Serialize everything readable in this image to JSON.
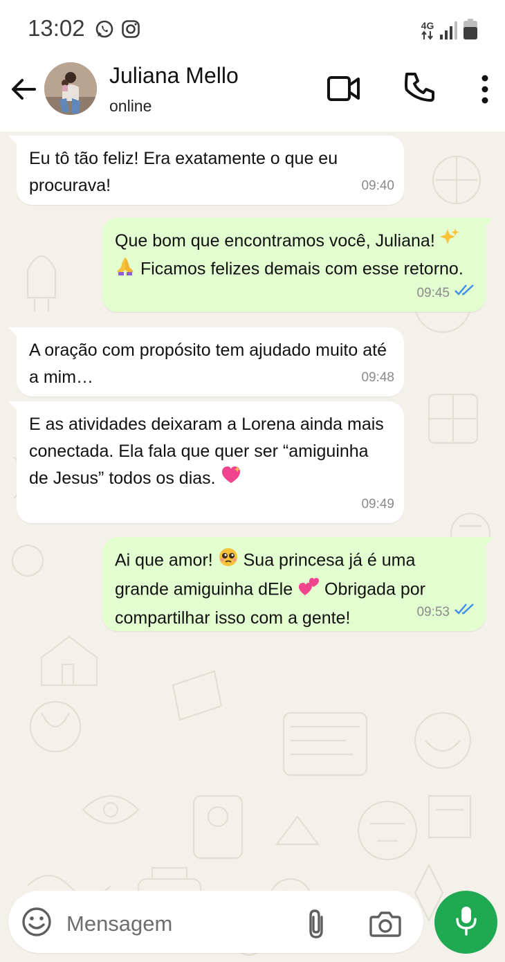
{
  "status_bar": {
    "time": "13:02",
    "left_icons": [
      "whatsapp-icon",
      "instagram-icon"
    ],
    "network": "4G",
    "right_icons": [
      "network-arrows-icon",
      "signal-icon",
      "battery-icon"
    ]
  },
  "header": {
    "contact_name": "Juliana Mello",
    "contact_status": "online",
    "icons": [
      "back-arrow-icon",
      "video-call-icon",
      "phone-call-icon",
      "more-options-icon"
    ]
  },
  "messages": [
    {
      "direction": "in",
      "text": "Eu tô tão feliz! Era exatamente o que eu procurava!",
      "time": "09:40"
    },
    {
      "direction": "out",
      "text_parts": [
        "Que bom que encontramos você, Juliana! ",
        " ",
        " Ficamos felizes demais com esse retorno."
      ],
      "emojis": [
        "sparkles-emoji",
        "praying-hands-emoji"
      ],
      "time": "09:45",
      "read": true
    },
    {
      "direction": "in",
      "text": "A oração com propósito tem ajudado muito até a mim…",
      "time": "09:48"
    },
    {
      "direction": "in",
      "text": "E as atividades deixaram a Lorena ainda mais conectada. Ela fala que quer ser “amiguinha de Jesus” todos os dias. ",
      "emojis": [
        "sparkling-heart-emoji"
      ],
      "time": "09:49"
    },
    {
      "direction": "out",
      "text_parts": [
        "Ai que amor! ",
        " Sua princesa já é uma grande amiguinha dEle ",
        " Obrigada por compartilhar isso com a gente!"
      ],
      "emojis": [
        "pleading-face-emoji",
        "two-hearts-emoji"
      ],
      "time": "09:53",
      "read": true
    }
  ],
  "composer": {
    "placeholder": "Mensagem",
    "icons": [
      "emoji-icon",
      "attach-icon",
      "camera-icon",
      "microphone-icon"
    ]
  },
  "colors": {
    "outgoing_bubble": "#e2fdd0",
    "incoming_bubble": "#ffffff",
    "chat_background": "#f4f1ea",
    "read_ticks": "#3a8fe8",
    "mic_button": "#1ea952"
  }
}
